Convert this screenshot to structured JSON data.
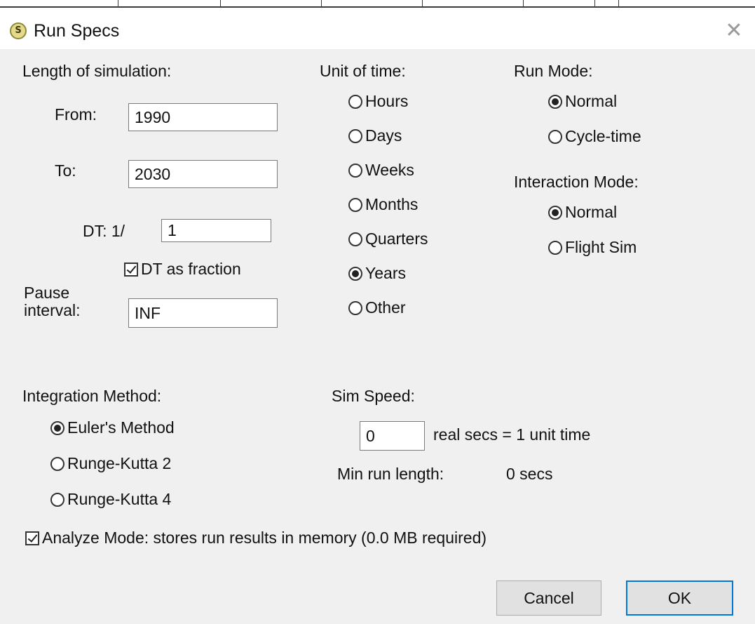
{
  "window": {
    "title": "Run Specs",
    "icon_glyph": "S",
    "close_glyph": "✕"
  },
  "length": {
    "heading": "Length of simulation:",
    "from_label": "From:",
    "from_value": "1990",
    "to_label": "To:",
    "to_value": "2030",
    "dt_label": "DT: 1/",
    "dt_value": "1",
    "dt_fraction_label": "DT as fraction",
    "dt_fraction_checked": true,
    "pause_label_1": "Pause",
    "pause_label_2": "interval:",
    "pause_value": "INF"
  },
  "unit_of_time": {
    "heading": "Unit of time:",
    "options": [
      {
        "label": "Hours",
        "selected": false
      },
      {
        "label": "Days",
        "selected": false
      },
      {
        "label": "Weeks",
        "selected": false
      },
      {
        "label": "Months",
        "selected": false
      },
      {
        "label": "Quarters",
        "selected": false
      },
      {
        "label": "Years",
        "selected": true
      },
      {
        "label": "Other",
        "selected": false
      }
    ]
  },
  "run_mode": {
    "heading": "Run Mode:",
    "options": [
      {
        "label": "Normal",
        "selected": true
      },
      {
        "label": "Cycle-time",
        "selected": false
      }
    ]
  },
  "interaction_mode": {
    "heading": "Interaction Mode:",
    "options": [
      {
        "label": "Normal",
        "selected": true
      },
      {
        "label": "Flight Sim",
        "selected": false
      }
    ]
  },
  "integration": {
    "heading": "Integration Method:",
    "options": [
      {
        "label": "Euler's Method",
        "selected": true
      },
      {
        "label": "Runge-Kutta 2",
        "selected": false
      },
      {
        "label": "Runge-Kutta 4",
        "selected": false
      }
    ]
  },
  "sim_speed": {
    "heading": "Sim Speed:",
    "value": "0",
    "suffix": "real secs = 1 unit time",
    "min_run_label": "Min run length:",
    "min_run_value": "0 secs"
  },
  "analyze": {
    "label": "Analyze Mode: stores run results in memory (0.0 MB required)",
    "checked": true
  },
  "buttons": {
    "cancel": "Cancel",
    "ok": "OK"
  },
  "colors": {
    "dialog_bg": "#f0f0f0",
    "default_button_border": "#0078d7",
    "icon_bg": "#e6d98a"
  }
}
